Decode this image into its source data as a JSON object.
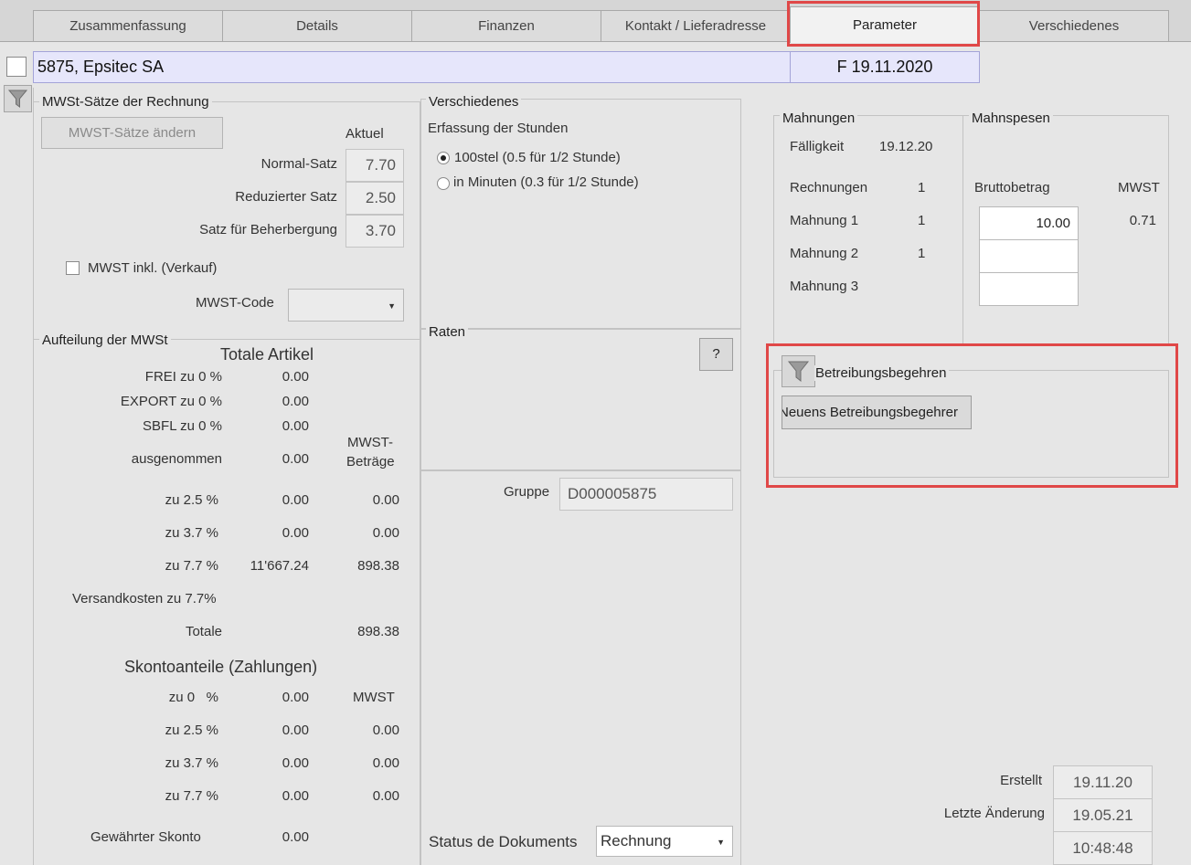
{
  "tabs": [
    "Zusammenfassung",
    "Details",
    "Finanzen",
    "Kontakt / Lieferadresse",
    "Parameter",
    "Verschiedenes"
  ],
  "header": {
    "record": "5875, Epsitec SA",
    "doc": "F 19.11.2020"
  },
  "mwst_rates": {
    "title": "MWSt-Sätze der Rechnung",
    "change_button": "MWST-Sätze ändern",
    "current_header": "Aktuel",
    "normal_label": "Normal-Satz",
    "normal_value": "7.70",
    "reduced_label": "Reduzierter Satz",
    "reduced_value": "2.50",
    "lodging_label": "Satz für Beherbergung",
    "lodging_value": "3.70",
    "inkl_label": "MWST inkl. (Verkauf)",
    "code_label": "MWST-Code",
    "code_value": ""
  },
  "breakdown": {
    "title": "Aufteilung der MWSt",
    "totals_header": "Totale Artikel",
    "mwst_header_1": "MWST-",
    "mwst_header_2": "Beträge",
    "rows": [
      {
        "label": "FREI zu 0 %",
        "total": "0.00",
        "mwst": ""
      },
      {
        "label": "EXPORT zu 0 %",
        "total": "0.00",
        "mwst": ""
      },
      {
        "label": "SBFL zu 0 %",
        "total": "0.00",
        "mwst": ""
      },
      {
        "label": "ausgenommen",
        "total": "0.00",
        "mwst": ""
      },
      {
        "label": "zu 2.5 %",
        "total": "0.00",
        "mwst": "0.00"
      },
      {
        "label": "zu 3.7 %",
        "total": "0.00",
        "mwst": "0.00"
      },
      {
        "label": "zu 7.7 %",
        "total": "11'667.24",
        "mwst": "898.38"
      }
    ],
    "shipping_label": "Versandkosten zu 7.7%",
    "totale_label": "Totale",
    "totale_value": "898.38",
    "skonto_header": "Skontoanteile (Zahlungen)",
    "skonto_mwst_header": "MWST",
    "skonto_rows": [
      {
        "label": "zu 0   %",
        "total": "0.00",
        "mwst": ""
      },
      {
        "label": "zu 2.5 %",
        "total": "0.00",
        "mwst": "0.00"
      },
      {
        "label": "zu 3.7 %",
        "total": "0.00",
        "mwst": "0.00"
      },
      {
        "label": "zu 7.7 %",
        "total": "0.00",
        "mwst": "0.00"
      }
    ],
    "granted_label": "Gewährter Skonto",
    "granted_value": "0.00"
  },
  "misc": {
    "title": "Verschiedenes",
    "hours_label": "Erfassung der Stunden",
    "option1": "100stel (0.5 für 1/2 Stunde)",
    "option2": "in Minuten (0.3 für 1/2 Stunde)"
  },
  "raten": {
    "title": "Raten",
    "help_button": "?"
  },
  "gruppe": {
    "label": "Gruppe",
    "value": "D000005875"
  },
  "status": {
    "label": "Status de Dokuments",
    "value": "Rechnung"
  },
  "mahnungen": {
    "title": "Mahnungen",
    "faellig_label": "Fälligkeit",
    "faellig_value": "19.12.20",
    "rows": [
      {
        "label": "Rechnungen",
        "count": "1"
      },
      {
        "label": "Mahnung 1",
        "count": "1"
      },
      {
        "label": "Mahnung 2",
        "count": "1"
      },
      {
        "label": "Mahnung 3",
        "count": ""
      }
    ]
  },
  "mahnspesen": {
    "title": "Mahnspesen",
    "brutto_header": "Bruttobetrag",
    "mwst_header": "MWST",
    "values": [
      {
        "brutto": "10.00",
        "mwst": "0.71"
      },
      {
        "brutto": "",
        "mwst": ""
      },
      {
        "brutto": "",
        "mwst": ""
      }
    ]
  },
  "betreibung": {
    "title": "Betreibungsbegehren",
    "button": "Neuens Betreibungsbegehrer"
  },
  "footer": {
    "created_label": "Erstellt",
    "created_value": "19.11.20",
    "modified_label": "Letzte Änderung",
    "modified_date": "19.05.21",
    "modified_time": "10:48:48"
  }
}
